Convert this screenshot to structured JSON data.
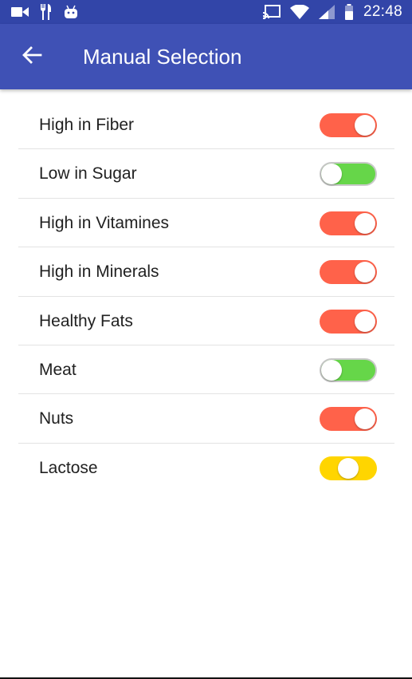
{
  "status_bar": {
    "time": "22:48",
    "left_icons": [
      "video-camera-icon",
      "restaurant-icon",
      "android-icon"
    ],
    "right_icons": [
      "cast-icon",
      "wifi-icon",
      "signal-icon",
      "battery-icon"
    ]
  },
  "app_bar": {
    "title": "Manual Selection",
    "back_icon": "arrow-back-icon",
    "color": "#3f51b5"
  },
  "toggle_colors": {
    "on": "#ff624a",
    "off": "#66d649",
    "partial": "#ffd500"
  },
  "items": [
    {
      "label": "High in Fiber",
      "state": "on"
    },
    {
      "label": "Low in Sugar",
      "state": "off"
    },
    {
      "label": "High in Vitamines",
      "state": "on"
    },
    {
      "label": "High in Minerals",
      "state": "on"
    },
    {
      "label": "Healthy Fats",
      "state": "on"
    },
    {
      "label": "Meat",
      "state": "off"
    },
    {
      "label": "Nuts",
      "state": "on"
    },
    {
      "label": "Lactose",
      "state": "partial"
    }
  ]
}
